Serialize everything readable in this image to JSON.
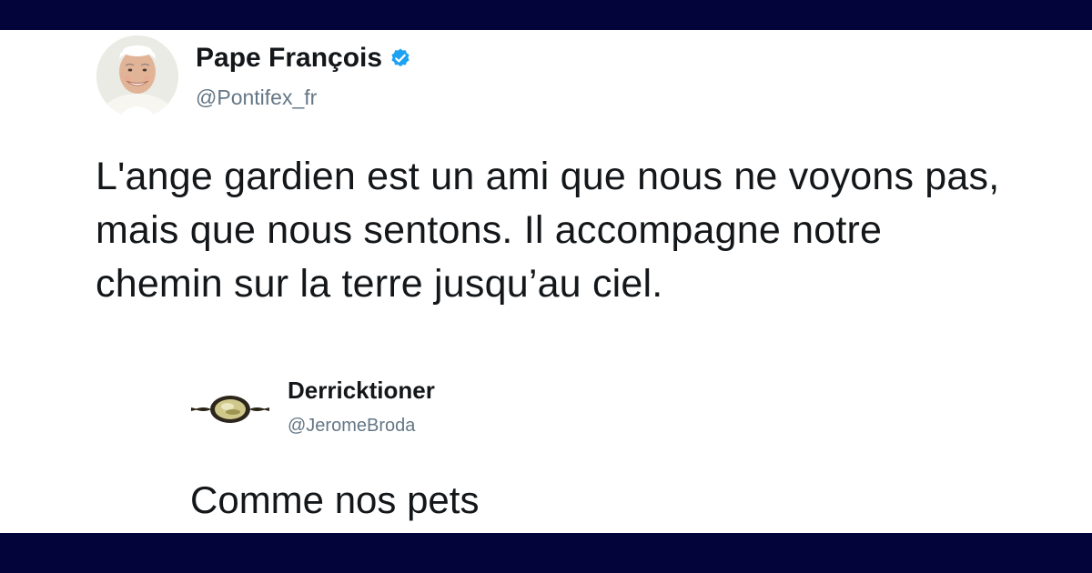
{
  "tweet": {
    "author_name": "Pape François",
    "author_handle": "@Pontifex_fr",
    "verified_icon": "verified-badge-icon",
    "text": "L'ange gardien est un ami que nous ne voyons pas, mais que nous sentons. Il accompagne notre chemin sur la terre jusqu’au ciel."
  },
  "reply": {
    "author_name": "Derricktioner",
    "author_handle": "@JeromeBroda",
    "text": "Comme nos pets"
  },
  "colors": {
    "band": "#03043a",
    "card_bg": "#ffffff",
    "text": "#14171a",
    "secondary_text": "#657786",
    "verified_blue": "#1da1f2"
  }
}
